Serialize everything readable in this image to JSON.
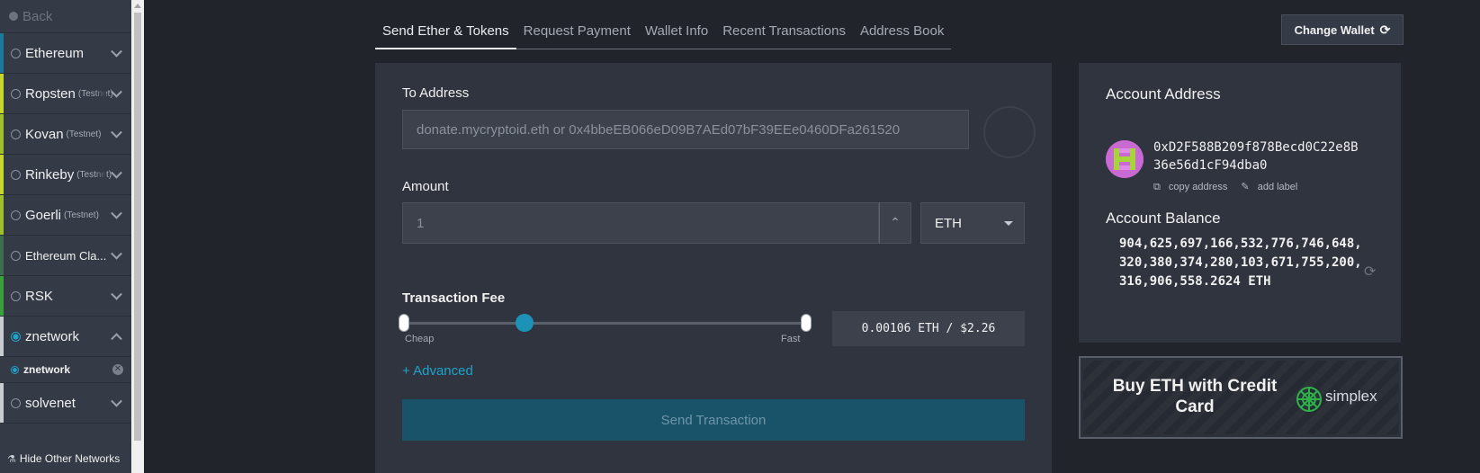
{
  "sidebar": {
    "back_label": "Back",
    "networks": [
      {
        "name": "Ethereum",
        "tag": "",
        "color": "#1a7a9a",
        "expanded": false
      },
      {
        "name": "Ropsten",
        "tag": "(Testnet)",
        "color": "#c6d62a",
        "expanded": false
      },
      {
        "name": "Kovan",
        "tag": "(Testnet)",
        "color": "#9fbf2c",
        "expanded": false
      },
      {
        "name": "Rinkeby",
        "tag": "(Testnet)",
        "color": "#c6d62a",
        "expanded": false
      },
      {
        "name": "Goerli",
        "tag": "(Testnet)",
        "color": "#9fbf2c",
        "expanded": false
      },
      {
        "name": "Ethereum Cla...",
        "tag": "",
        "color": "#3f6e4f",
        "expanded": false
      },
      {
        "name": "RSK",
        "tag": "",
        "color": "#3aa13a",
        "expanded": false
      },
      {
        "name": "znetwork",
        "tag": "",
        "color": "#c8ccd2",
        "expanded": true
      },
      {
        "name": "solvenet",
        "tag": "",
        "color": "#c8ccd2",
        "expanded": false
      }
    ],
    "sub_node": "znetwork",
    "hide_other_label": "Hide Other Networks"
  },
  "tabs": [
    "Send Ether & Tokens",
    "Request Payment",
    "Wallet Info",
    "Recent Transactions",
    "Address Book"
  ],
  "change_wallet_label": "Change Wallet",
  "send": {
    "to_address_label": "To Address",
    "to_address_placeholder": "donate.mycryptoid.eth or 0x4bbeEB066eD09B7AEd07bF39EEe0460DFa261520",
    "amount_label": "Amount",
    "amount_placeholder": "1",
    "unit": "ETH",
    "fee_label": "Transaction Fee",
    "fee_cheap": "Cheap",
    "fee_fast": "Fast",
    "fee_slider_fraction": 0.3,
    "fee_value": "0.00106 ETH / $2.26",
    "advanced_label": "+ Advanced",
    "send_button": "Send Transaction"
  },
  "account": {
    "address_title": "Account Address",
    "address": "0xD2F588B209f878Becd0C22e8B36e56d1cF94dba0",
    "copy_label": "copy address",
    "add_label": "add label",
    "balance_title": "Account Balance",
    "balance": "904,625,697,166,532,776,746,648,320,380,374,280,103,671,755,200,316,906,558.2624 ETH"
  },
  "promo": {
    "text": "Buy ETH with Credit Card",
    "brand": "simplex"
  },
  "colors": {
    "accent": "#1fa3cb",
    "panel": "#2f343e",
    "background": "#21252b",
    "sidebar": "#343a46"
  }
}
